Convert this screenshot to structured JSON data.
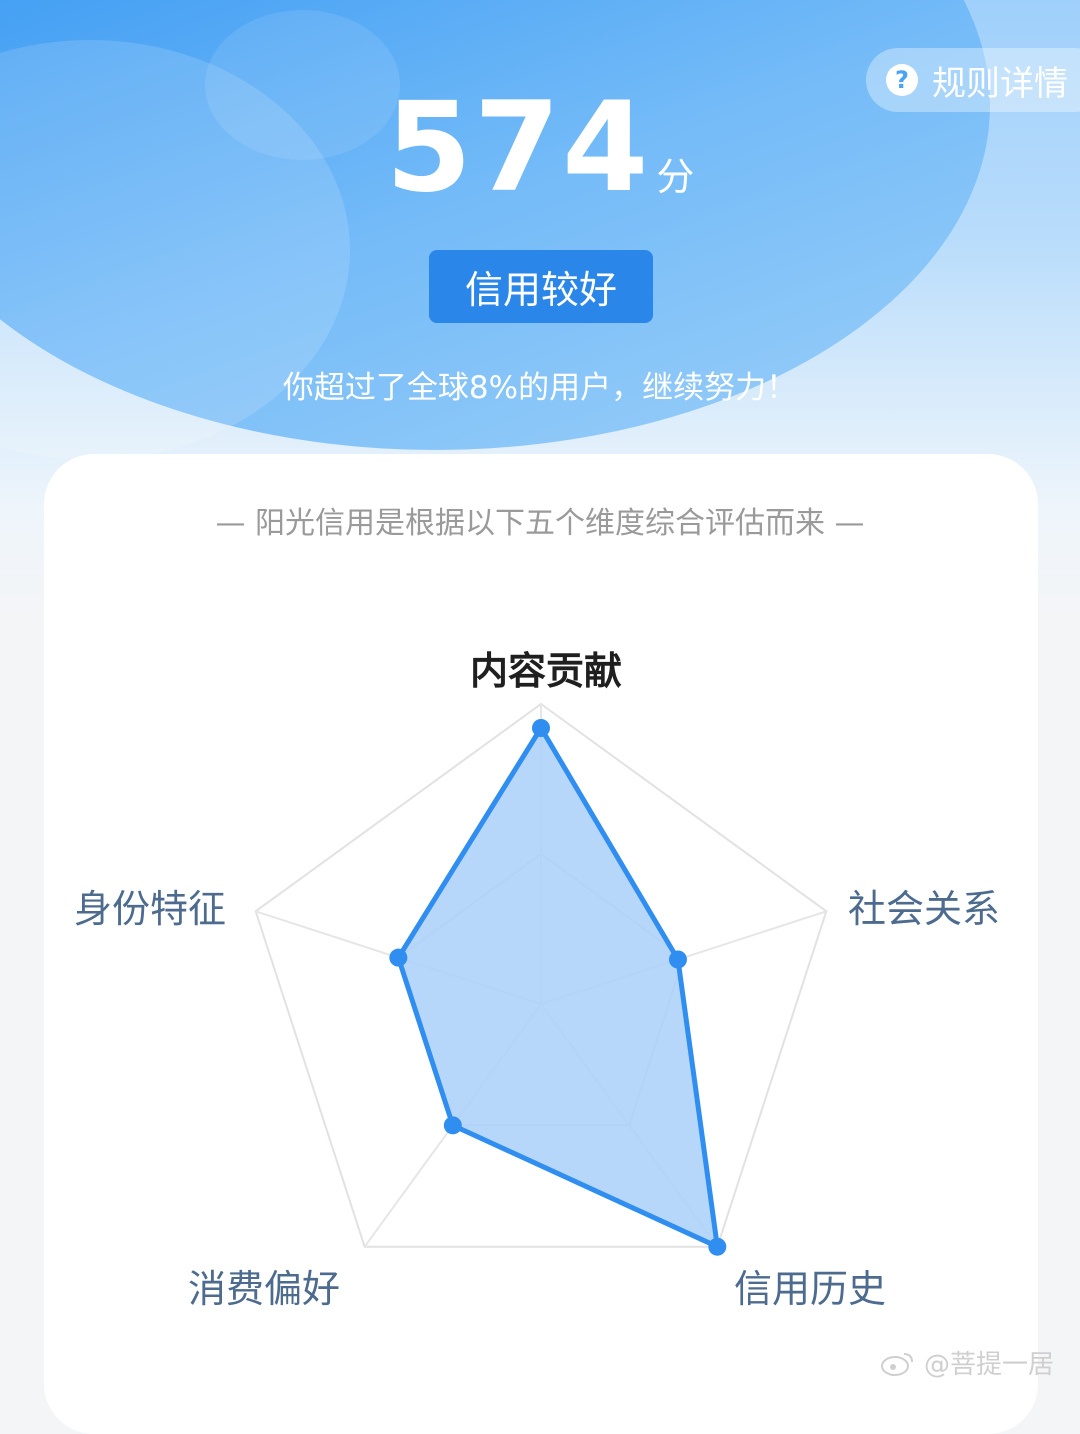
{
  "header": {
    "rules_label": "规则详情",
    "rules_icon": "question-circle-icon",
    "score_value": "574",
    "score_unit": "分",
    "level_label": "信用较好",
    "percentile_text": "你超过了全球8%的用户，继续努力！"
  },
  "card": {
    "title": "— 阳光信用是根据以下五个维度综合评估而来 —"
  },
  "radar": {
    "labels": {
      "content": "内容贡献",
      "social": "社会关系",
      "history": "信用历史",
      "consumption": "消费偏好",
      "identity": "身份特征"
    },
    "accent_color": "#2f8ef0",
    "fill_color": "#a9d0f8"
  },
  "chart_data": {
    "type": "radar",
    "categories": [
      "内容贡献",
      "社会关系",
      "信用历史",
      "消费偏好",
      "身份特征"
    ],
    "values": [
      0.92,
      0.48,
      1.0,
      0.5,
      0.5
    ],
    "range": [
      0,
      1
    ]
  },
  "watermark": {
    "text": "@菩提一居",
    "icon": "weibo-icon"
  }
}
